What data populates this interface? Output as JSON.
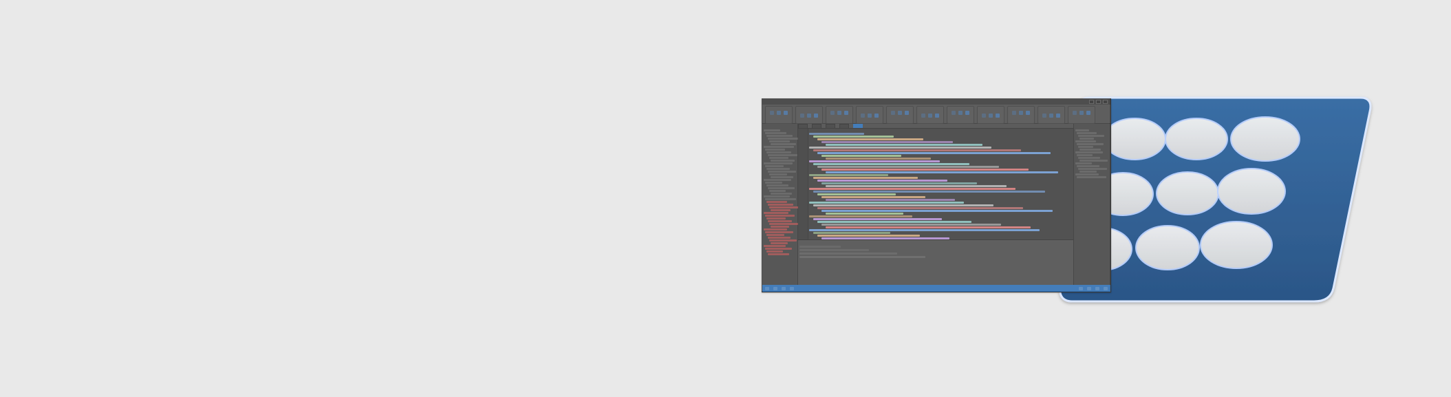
{
  "scene": {
    "description": "",
    "background_color": "#e9e9e9"
  },
  "ide": {
    "window": {
      "title": "",
      "controls": [
        "minimize",
        "maximize",
        "close"
      ]
    },
    "ribbon": {
      "groups": [
        {
          "name": "group-1"
        },
        {
          "name": "group-2"
        },
        {
          "name": "group-3"
        },
        {
          "name": "group-4"
        },
        {
          "name": "group-5"
        },
        {
          "name": "group-6"
        },
        {
          "name": "group-7"
        },
        {
          "name": "group-8"
        },
        {
          "name": "group-9"
        },
        {
          "name": "group-10"
        },
        {
          "name": "group-11"
        }
      ]
    },
    "tabs": [
      {
        "label": "",
        "active": false
      },
      {
        "label": "",
        "active": false
      },
      {
        "label": "",
        "active": false
      },
      {
        "label": "",
        "active": false
      },
      {
        "label": "",
        "active": true
      }
    ],
    "left_panel": {
      "title": "",
      "rows": 46,
      "red_rows_start": 26
    },
    "right_panel": {
      "title": "",
      "rows": 18
    },
    "editor": {
      "lines": 40
    },
    "output": {
      "title": "",
      "lines": 4
    },
    "statusbar": {
      "left": [
        "",
        "",
        "",
        ""
      ],
      "right": [
        "",
        "",
        "",
        ""
      ]
    },
    "colors": {
      "accent": "#2f6fb3",
      "bg": "#4a4a4a",
      "panel": "#454545",
      "editor": "#3f3f3f"
    }
  },
  "ribbon_card": {
    "fill": "#2f5f92",
    "stroke": "#dce8ff",
    "hole_fill": "#e8e8e8",
    "hole_count": 9
  }
}
